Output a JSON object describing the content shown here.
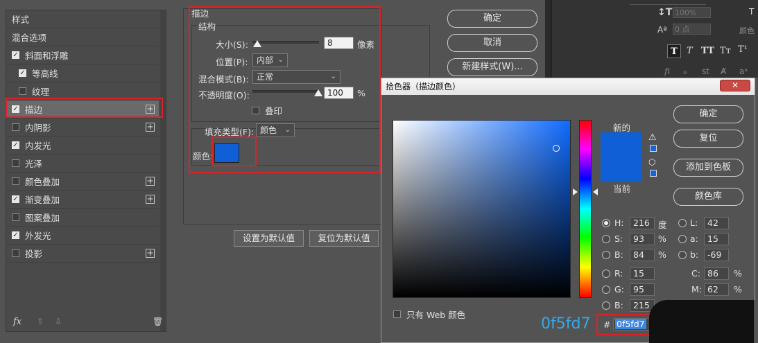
{
  "styles_panel": {
    "header": "样式",
    "items": [
      {
        "label": "混合选项",
        "checkbox": false,
        "checked": false,
        "plus": false,
        "selected": false
      },
      {
        "label": "斜面和浮雕",
        "checkbox": true,
        "checked": true,
        "plus": false,
        "selected": false
      },
      {
        "label": "等高线",
        "checkbox": true,
        "checked": true,
        "plus": false,
        "selected": false,
        "indent": true
      },
      {
        "label": "纹理",
        "checkbox": true,
        "checked": false,
        "plus": false,
        "selected": false,
        "indent": true
      },
      {
        "label": "描边",
        "checkbox": true,
        "checked": true,
        "plus": true,
        "selected": true
      },
      {
        "label": "内阴影",
        "checkbox": true,
        "checked": false,
        "plus": true,
        "selected": false
      },
      {
        "label": "内发光",
        "checkbox": true,
        "checked": true,
        "plus": false,
        "selected": false
      },
      {
        "label": "光泽",
        "checkbox": true,
        "checked": false,
        "plus": false,
        "selected": false
      },
      {
        "label": "颜色叠加",
        "checkbox": true,
        "checked": false,
        "plus": true,
        "selected": false
      },
      {
        "label": "渐变叠加",
        "checkbox": true,
        "checked": true,
        "plus": true,
        "selected": false
      },
      {
        "label": "图案叠加",
        "checkbox": true,
        "checked": false,
        "plus": false,
        "selected": false
      },
      {
        "label": "外发光",
        "checkbox": true,
        "checked": true,
        "plus": false,
        "selected": false
      },
      {
        "label": "投影",
        "checkbox": true,
        "checked": false,
        "plus": true,
        "selected": false
      }
    ],
    "footer_fx": "fx"
  },
  "stroke": {
    "title": "描边",
    "structure_title": "结构",
    "size_label": "大小(S):",
    "size_value": "8",
    "size_unit": "像素",
    "position_label": "位置(P):",
    "position_value": "内部",
    "blend_label": "混合模式(B):",
    "blend_value": "正常",
    "opacity_label": "不透明度(O):",
    "opacity_value": "100",
    "opacity_unit": "%",
    "overprint_label": "叠印",
    "fill_type_label": "填充类型(F):",
    "fill_type_value": "颜色",
    "color_label": "颜色:",
    "color": "#0f5fd7"
  },
  "buttons": {
    "ok": "确定",
    "cancel": "取消",
    "new_style": "新建样式(W)...",
    "set_default": "设置为默认值",
    "reset_default": "复位为默认值"
  },
  "picker": {
    "title": "拾色器（描边颜色）",
    "ok": "确定",
    "reset": "复位",
    "add_swatch": "添加到色板",
    "color_libraries": "颜色库",
    "new_label": "新的",
    "current_label": "当前",
    "new_color": "#0f5fd7",
    "current_color": "#0f5fd7",
    "web_only_label": "只有 Web 颜色",
    "hex_prefix": "#",
    "hex_value": "0f5fd7",
    "hex_overlay": "0f5fd7",
    "fields": {
      "H": {
        "label": "H:",
        "value": "216",
        "unit": "度"
      },
      "S": {
        "label": "S:",
        "value": "93",
        "unit": "%"
      },
      "B": {
        "label": "B:",
        "value": "84",
        "unit": "%"
      },
      "R": {
        "label": "R:",
        "value": "15"
      },
      "G": {
        "label": "G:",
        "value": "95"
      },
      "Bb": {
        "label": "B:",
        "value": "215"
      },
      "L": {
        "label": "L:",
        "value": "42"
      },
      "a": {
        "label": "a:",
        "value": "15"
      },
      "b": {
        "label": "b:",
        "value": "-69"
      },
      "C": {
        "label": "C:",
        "value": "86",
        "unit": "%"
      },
      "M": {
        "label": "M:",
        "value": "62",
        "unit": "%"
      },
      "Y": {
        "unit": "%"
      }
    }
  },
  "right_panel": {
    "leading_value": "100%",
    "tracking_value": "0 点",
    "color_label": "颜色"
  }
}
